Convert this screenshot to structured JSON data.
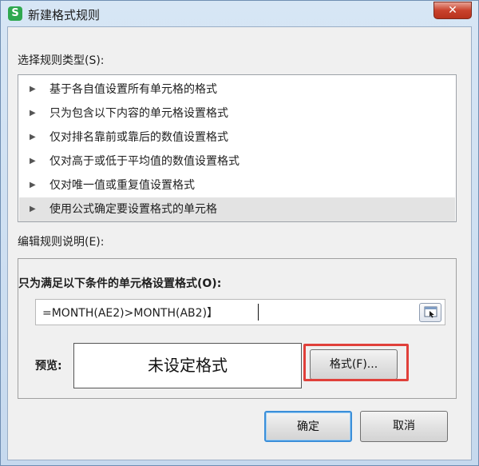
{
  "window": {
    "title": "新建格式规则",
    "app_icon_letter": "S",
    "close_glyph": "✕"
  },
  "rule_type": {
    "label": "选择规则类型(S):",
    "items": [
      {
        "label": "基于各自值设置所有单元格的格式",
        "selected": false
      },
      {
        "label": "只为包含以下内容的单元格设置格式",
        "selected": false
      },
      {
        "label": "仅对排名靠前或靠后的数值设置格式",
        "selected": false
      },
      {
        "label": "仅对高于或低于平均值的数值设置格式",
        "selected": false
      },
      {
        "label": "仅对唯一值或重复值设置格式",
        "selected": false
      },
      {
        "label": "使用公式确定要设置格式的单元格",
        "selected": true
      }
    ],
    "arrow_glyph": "▶"
  },
  "rule_description": {
    "label": "编辑规则说明(E):",
    "heading": "只为满足以下条件的单元格设置格式(O):",
    "formula_value": "=MONTH(AE2)>MONTH(AB2)】",
    "preview_label": "预览:",
    "preview_text": "未设定格式",
    "format_button": "格式(F)..."
  },
  "footer": {
    "ok_button": "确定",
    "cancel_button": "取消"
  },
  "colors": {
    "highlight": "#e0403a",
    "selected_row": "#e3e3e3",
    "ok_focus": "#3c8fd9"
  }
}
